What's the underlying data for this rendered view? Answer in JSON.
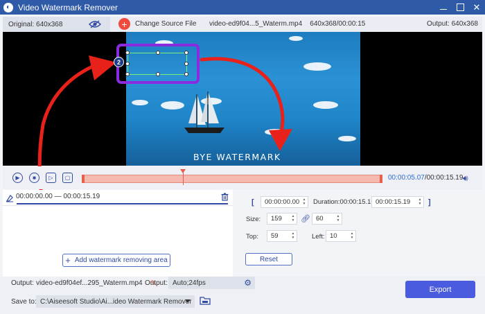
{
  "window": {
    "title": "Video Watermark Remover"
  },
  "infobar": {
    "original_label": "Original: 640x368",
    "change_source_label": "Change Source File",
    "file_info": "video-ed9f04...5_Waterm.mp4    640x368/00:00:15",
    "output_label": "Output: 640x368"
  },
  "video": {
    "watermark_text": "BYE WATERMARK"
  },
  "annotations": {
    "step1": "1",
    "step2": "2"
  },
  "timeline": {
    "current_time": "00:00:05.07",
    "total_time": "/00:00:15.19"
  },
  "segment": {
    "range": "00:00:00.00 — 00:00:15.19"
  },
  "left_panel": {
    "add_area_label": "Add watermark removing area"
  },
  "right_panel": {
    "start_time": "00:00:00.00",
    "duration_label": "Duration:00:00:15.19",
    "end_time": "00:00:15.19",
    "size_label": "Size:",
    "width": "159",
    "height": "60",
    "top_label": "Top:",
    "top": "59",
    "left_label": "Left:",
    "left": "10",
    "reset_label": "Reset"
  },
  "bottom": {
    "output_label": "Output:",
    "output_file": "video-ed9f04ef...295_Waterm.mp4",
    "output_settings_label": "Output:",
    "output_settings": "Auto;24fps",
    "save_to_label": "Save to:",
    "save_path": "C:\\Aiseesoft Studio\\Ai...ideo Watermark Remover",
    "export_label": "Export"
  },
  "colors": {
    "accent": "#2f4aa0",
    "highlight": "#8a2be2",
    "arrow": "#e8211a",
    "export": "#4a5be0"
  }
}
